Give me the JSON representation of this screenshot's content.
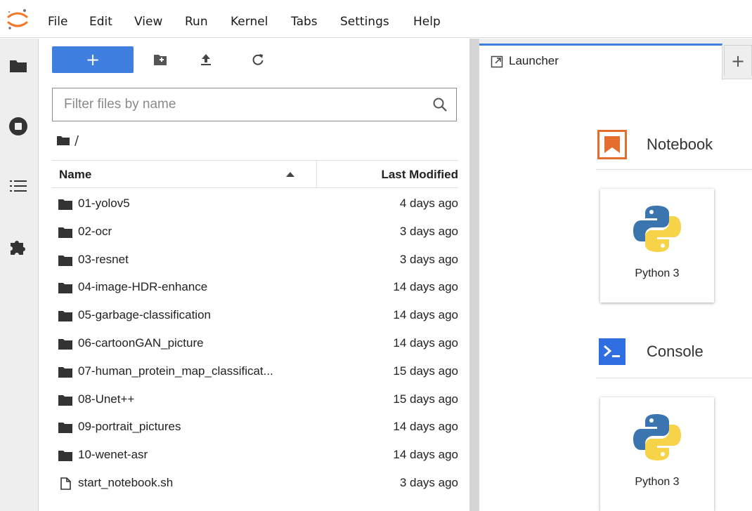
{
  "menu": [
    "File",
    "Edit",
    "View",
    "Run",
    "Kernel",
    "Tabs",
    "Settings",
    "Help"
  ],
  "sidebar": {
    "icons": [
      "folder-icon",
      "running-icon",
      "toc-icon",
      "extension-icon"
    ]
  },
  "filebrowser": {
    "new_button_label": "+",
    "toolbar_icons": [
      "new-folder-icon",
      "upload-icon",
      "refresh-icon"
    ],
    "filter_placeholder": "Filter files by name",
    "breadcrumb": "/",
    "columns": {
      "name": "Name",
      "modified": "Last Modified"
    },
    "files": [
      {
        "name": "01-yolov5",
        "modified": "4 days ago",
        "type": "folder"
      },
      {
        "name": "02-ocr",
        "modified": "3 days ago",
        "type": "folder"
      },
      {
        "name": "03-resnet",
        "modified": "3 days ago",
        "type": "folder"
      },
      {
        "name": "04-image-HDR-enhance",
        "modified": "14 days ago",
        "type": "folder"
      },
      {
        "name": "05-garbage-classification",
        "modified": "14 days ago",
        "type": "folder"
      },
      {
        "name": "06-cartoonGAN_picture",
        "modified": "14 days ago",
        "type": "folder"
      },
      {
        "name": "07-human_protein_map_classificat...",
        "modified": "15 days ago",
        "type": "folder"
      },
      {
        "name": "08-Unet++",
        "modified": "15 days ago",
        "type": "folder"
      },
      {
        "name": "09-portrait_pictures",
        "modified": "14 days ago",
        "type": "folder"
      },
      {
        "name": "10-wenet-asr",
        "modified": "14 days ago",
        "type": "folder"
      },
      {
        "name": "start_notebook.sh",
        "modified": "3 days ago",
        "type": "file"
      }
    ]
  },
  "tabs": {
    "launcher_label": "Launcher",
    "add_label": "+"
  },
  "launcher": {
    "notebook_title": "Notebook",
    "console_title": "Console",
    "notebook_kernel": "Python 3",
    "console_kernel": "Python 3"
  },
  "colors": {
    "accent": "#3f7fe0",
    "notebook_icon": "#e46e2e",
    "console_icon": "#2f6ee0",
    "python_blue": "#3a75b0",
    "python_yellow": "#f7d34a"
  }
}
